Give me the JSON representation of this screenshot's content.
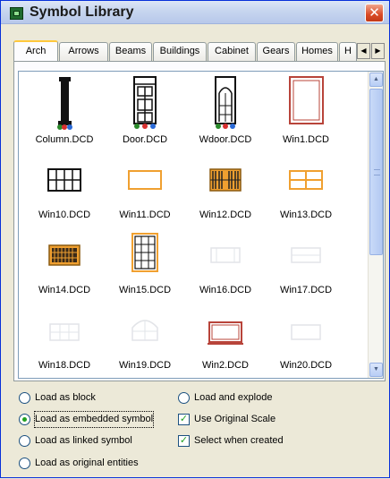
{
  "window": {
    "title": "Symbol Library",
    "close_glyph": "✕"
  },
  "tabs": [
    {
      "label": "Arch",
      "active": true
    },
    {
      "label": "Arrows",
      "active": false
    },
    {
      "label": "Beams",
      "active": false
    },
    {
      "label": "Buildings",
      "active": false
    },
    {
      "label": "Cabinet",
      "active": false
    },
    {
      "label": "Gears",
      "active": false
    },
    {
      "label": "Homes",
      "active": false
    },
    {
      "label": "H",
      "active": false
    }
  ],
  "tab_scroll": {
    "left": "◀",
    "right": "▶"
  },
  "scrollbar": {
    "up": "▲",
    "down": "▼"
  },
  "symbols": [
    {
      "name": "Column.DCD",
      "icon": "column-icon"
    },
    {
      "name": "Door.DCD",
      "icon": "door-icon"
    },
    {
      "name": "Wdoor.DCD",
      "icon": "wood-door-icon"
    },
    {
      "name": "Win1.DCD",
      "icon": "window-icon"
    },
    {
      "name": "Win10.DCD",
      "icon": "window-grid-icon"
    },
    {
      "name": "Win11.DCD",
      "icon": "window-plain-icon"
    },
    {
      "name": "Win12.DCD",
      "icon": "window-bars-icon"
    },
    {
      "name": "Win13.DCD",
      "icon": "window-quad-icon"
    },
    {
      "name": "Win14.DCD",
      "icon": "window-dense-icon"
    },
    {
      "name": "Win15.DCD",
      "icon": "window-tall-grid-icon"
    },
    {
      "name": "Win16.DCD",
      "icon": "window-faint-icon"
    },
    {
      "name": "Win17.DCD",
      "icon": "window-faint-icon"
    },
    {
      "name": "Win18.DCD",
      "icon": "window-faint-icon"
    },
    {
      "name": "Win19.DCD",
      "icon": "window-arch-faint-icon"
    },
    {
      "name": "Win2.DCD",
      "icon": "window-sill-icon"
    },
    {
      "name": "Win20.DCD",
      "icon": "window-faint-icon"
    }
  ],
  "options": {
    "load_as_block": {
      "label": "Load as block",
      "selected": false
    },
    "load_and_explode": {
      "label": "Load and explode",
      "selected": false
    },
    "load_as_embedded": {
      "label": "Load as embedded symbol",
      "selected": true
    },
    "load_as_linked": {
      "label": "Load as linked symbol",
      "selected": false
    },
    "load_as_original": {
      "label": "Load as original entities",
      "selected": false
    },
    "use_original_scale": {
      "label": "Use Original Scale",
      "checked": true
    },
    "select_when_created": {
      "label": "Select when created",
      "checked": true
    }
  },
  "colors": {
    "window_bg": "#ece9d8",
    "accent_orange": "#f0a030",
    "brick_red": "#b8443a",
    "faint_gray": "#e2e4e8"
  }
}
